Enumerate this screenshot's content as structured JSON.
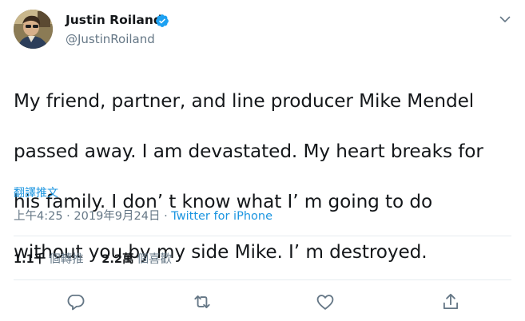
{
  "author": {
    "display_name": "Justin Roiland",
    "handle": "@JustinRoiland",
    "verified": true,
    "avatar": "profile-photo"
  },
  "tweet": {
    "lines": [
      "My friend, partner, and line producer Mike Mendel",
      "passed away. I am devastated. My heart breaks for",
      "his family. I don’ t know what I’ m going to do",
      "without you by my side Mike. I’ m destroyed."
    ],
    "translate_label": "翻譯推文",
    "time": "上午4:25",
    "separator": "·",
    "date": "2019年9月24日",
    "source": "Twitter for iPhone"
  },
  "stats": {
    "retweets_count": "1.1千",
    "retweets_label": "個轉推",
    "likes_count": "2.2萬",
    "likes_label": "個喜歡"
  },
  "icons": {
    "menu": "chevron-down-icon",
    "reply": "reply-icon",
    "retweet": "retweet-icon",
    "like": "heart-icon",
    "share": "share-icon"
  },
  "colors": {
    "text": "#14171a",
    "secondary": "#657786",
    "accent": "#1b95e0",
    "verified": "#1da1f2",
    "divider": "#e6ecf0"
  }
}
